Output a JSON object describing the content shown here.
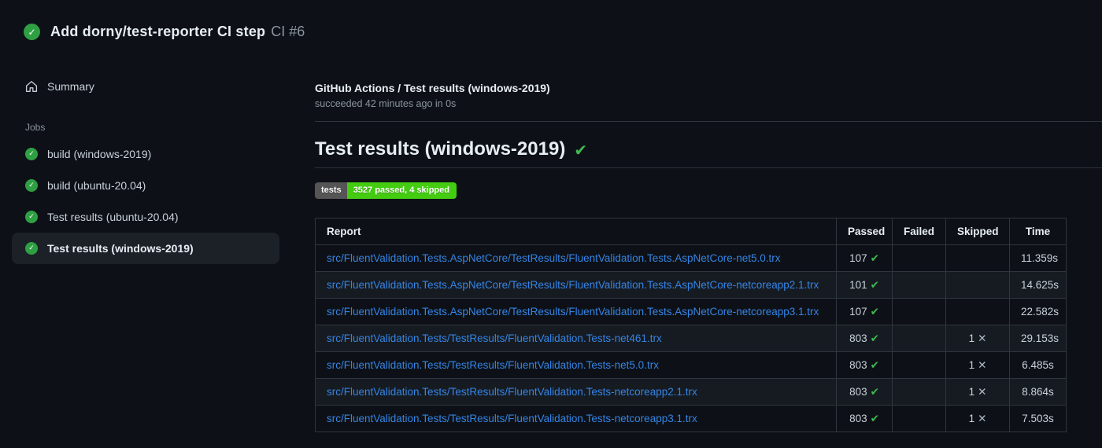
{
  "colors": {
    "background": "#0d1117",
    "panel_selected": "#1c2128",
    "row_alt": "#161b22",
    "border": "#30363d",
    "text": "#c9d1d9",
    "text_bright": "#e6edf3",
    "text_muted": "#8b949e",
    "link_blue": "#3584e4",
    "success_circle": "#2ea043",
    "success_check": "#3fb950",
    "badge_gray": "#555555",
    "badge_green": "#44cc11"
  },
  "icons": {
    "circle_check": "✓",
    "heavy_check": "✔",
    "cross": "✕",
    "house": "home-icon"
  },
  "run_header": {
    "title": "Add dorny/test-reporter CI step",
    "run_number": "CI #6"
  },
  "sidebar": {
    "summary_label": "Summary",
    "jobs_label": "Jobs",
    "jobs": [
      {
        "label": "build (windows-2019)",
        "selected": false
      },
      {
        "label": "build (ubuntu-20.04)",
        "selected": false
      },
      {
        "label": "Test results (ubuntu-20.04)",
        "selected": false
      },
      {
        "label": "Test results (windows-2019)",
        "selected": true
      }
    ]
  },
  "main": {
    "breadcrumb": "GitHub Actions / Test results (windows-2019)",
    "status_line": "succeeded 42 minutes ago in 0s",
    "heading": "Test results (windows-2019)",
    "badge": {
      "label": "tests",
      "value": "3527 passed, 4 skipped"
    },
    "table": {
      "columns": [
        "Report",
        "Passed",
        "Failed",
        "Skipped",
        "Time"
      ],
      "rows": [
        {
          "report": "src/FluentValidation.Tests.AspNetCore/TestResults/FluentValidation.Tests.AspNetCore-net5.0.trx",
          "passed": "107",
          "passed_icon": "✔",
          "failed": "",
          "skipped": "",
          "skipped_icon": "",
          "time": "11.359s"
        },
        {
          "report": "src/FluentValidation.Tests.AspNetCore/TestResults/FluentValidation.Tests.AspNetCore-netcoreapp2.1.trx",
          "passed": "101",
          "passed_icon": "✔",
          "failed": "",
          "skipped": "",
          "skipped_icon": "",
          "time": "14.625s"
        },
        {
          "report": "src/FluentValidation.Tests.AspNetCore/TestResults/FluentValidation.Tests.AspNetCore-netcoreapp3.1.trx",
          "passed": "107",
          "passed_icon": "✔",
          "failed": "",
          "skipped": "",
          "skipped_icon": "",
          "time": "22.582s"
        },
        {
          "report": "src/FluentValidation.Tests/TestResults/FluentValidation.Tests-net461.trx",
          "passed": "803",
          "passed_icon": "✔",
          "failed": "",
          "skipped": "1",
          "skipped_icon": "✕",
          "time": "29.153s"
        },
        {
          "report": "src/FluentValidation.Tests/TestResults/FluentValidation.Tests-net5.0.trx",
          "passed": "803",
          "passed_icon": "✔",
          "failed": "",
          "skipped": "1",
          "skipped_icon": "✕",
          "time": "6.485s"
        },
        {
          "report": "src/FluentValidation.Tests/TestResults/FluentValidation.Tests-netcoreapp2.1.trx",
          "passed": "803",
          "passed_icon": "✔",
          "failed": "",
          "skipped": "1",
          "skipped_icon": "✕",
          "time": "8.864s"
        },
        {
          "report": "src/FluentValidation.Tests/TestResults/FluentValidation.Tests-netcoreapp3.1.trx",
          "passed": "803",
          "passed_icon": "✔",
          "failed": "",
          "skipped": "1",
          "skipped_icon": "✕",
          "time": "7.503s"
        }
      ]
    }
  }
}
